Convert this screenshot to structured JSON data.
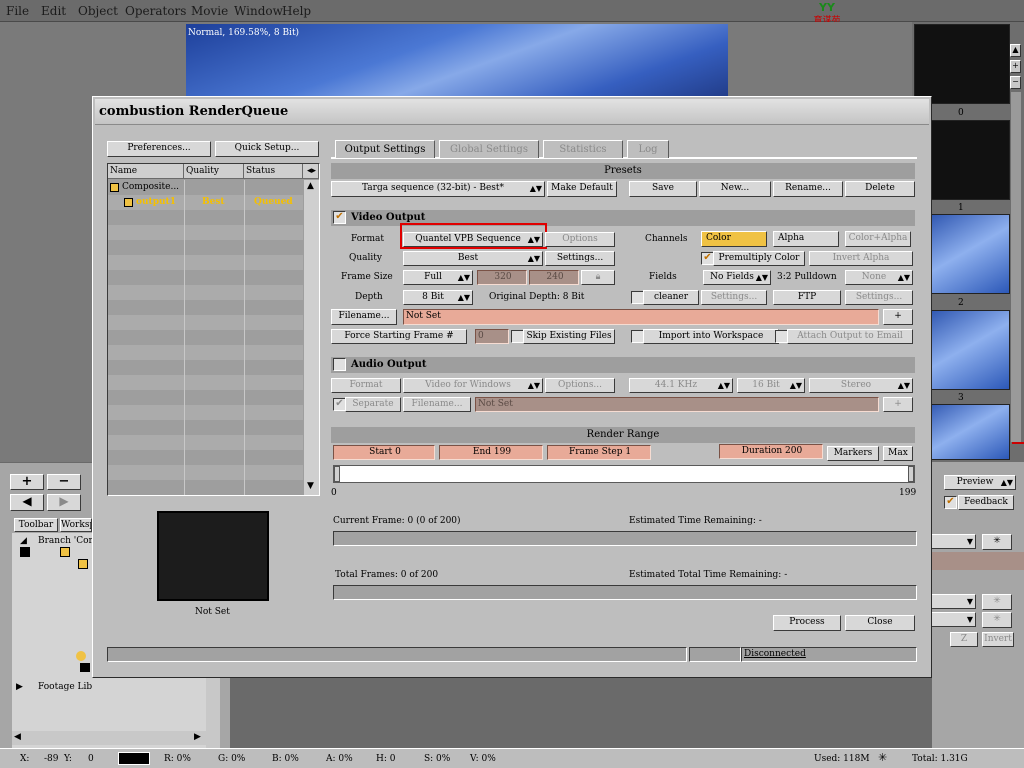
{
  "menubar": {
    "items": [
      "File",
      "Edit",
      "Object",
      "Operators",
      "Movie",
      "Window",
      "Help"
    ],
    "logo_text": "YY",
    "logo_sub": "育谋苑"
  },
  "viewer": {
    "label": "Normal, 169.58%, 8 Bit)"
  },
  "thumbs": {
    "labels": [
      "0",
      "1",
      "2",
      "3"
    ]
  },
  "dialog": {
    "title": "combustion RenderQueue",
    "preferences": "Preferences...",
    "quick_setup": "Quick Setup...",
    "queue": {
      "headers": [
        "Name",
        "Quality",
        "Status"
      ],
      "rows": [
        {
          "name": "Composite...",
          "quality": "",
          "status": ""
        },
        {
          "name": "output1",
          "quality": "Best",
          "status": "Queued"
        }
      ]
    },
    "preview_label": "Not Set",
    "tabs": [
      "Output Settings",
      "Global Settings",
      "Statistics",
      "Log"
    ],
    "presets": {
      "header": "Presets",
      "value": "Targa sequence (32-bit) - Best*",
      "make_default": "Make Default",
      "save": "Save",
      "new": "New...",
      "rename": "Rename...",
      "delete": "Delete"
    },
    "video": {
      "header": "Video Output",
      "format_label": "Format",
      "format_value": "Quantel VPB Sequence",
      "options": "Options",
      "channels_label": "Channels",
      "color": "Color",
      "alpha": "Alpha",
      "color_alpha": "Color+Alpha",
      "quality_label": "Quality",
      "quality_value": "Best",
      "settings": "Settings...",
      "premultiply": "Premultiply Color",
      "invert_alpha": "Invert Alpha",
      "frame_size_label": "Frame Size",
      "frame_size_value": "Full",
      "width": "320",
      "height": "240",
      "fields_label": "Fields",
      "fields_value": "No Fields",
      "pulldown_label": "3:2 Pulldown",
      "pulldown_value": "None",
      "depth_label": "Depth",
      "depth_value": "8 Bit",
      "original_depth": "Original Depth:  8 Bit",
      "cleaner": "cleaner",
      "settings2": "Settings...",
      "ftp": "FTP",
      "settings3": "Settings...",
      "filename_btn": "Filename...",
      "filename_value": "Not Set",
      "plus": "+",
      "force_frame": "Force Starting Frame #",
      "force_value": "0",
      "skip_existing": "Skip Existing Files",
      "import_ws": "Import into Workspace",
      "attach_email": "Attach Output to Email"
    },
    "audio": {
      "header": "Audio Output",
      "format_label": "Format",
      "format_value": "Video for Windows",
      "options": "Options...",
      "rate": "44.1 KHz",
      "bits": "16 Bit",
      "channels": "Stereo",
      "separate": "Separate",
      "filename_btn": "Filename...",
      "filename_value": "Not Set",
      "plus": "+"
    },
    "render_range": {
      "header": "Render Range",
      "start": "Start 0",
      "end": "End 199",
      "step": "Frame Step 1",
      "duration": "Duration 200",
      "markers": "Markers",
      "max": "Max",
      "min_tick": "0",
      "max_tick": "199"
    },
    "progress": {
      "current_frame": "Current Frame:  0 (0 of 200)",
      "est_remaining": "Estimated Time Remaining:  -",
      "total_frames": "Total Frames:  0 of 200",
      "est_total": "Estimated Total Time Remaining:  -"
    },
    "process": "Process",
    "close": "Close",
    "status": "Disconnected"
  },
  "workspace": {
    "tabs": [
      "Toolbar",
      "Worksp"
    ],
    "branch": "Branch 'Com",
    "footage": "Footage Lib",
    "preview": "Preview",
    "feedback": "Feedback",
    "z": "Z",
    "invert": "Invert"
  },
  "statusbar": {
    "x": "X:",
    "x_val": "-89",
    "y": "Y:",
    "y_val": "0",
    "r": "R: 0%",
    "g": "G: 0%",
    "b": "B: 0%",
    "a": "A: 0%",
    "h": "H: 0",
    "s": "S: 0%",
    "v": "V: 0%",
    "used": "Used: 118M",
    "total": "Total: 1.31G"
  }
}
